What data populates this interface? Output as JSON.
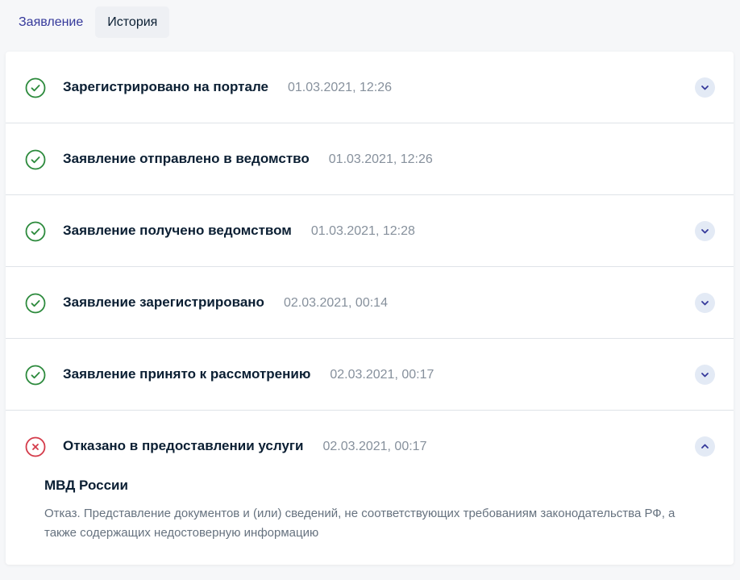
{
  "tabs": [
    {
      "label": "Заявление",
      "active": false
    },
    {
      "label": "История",
      "active": true
    }
  ],
  "history": [
    {
      "title": "Зарегистрировано на портале",
      "date": "01.03.2021, 12:26",
      "status": "success",
      "expandable": true,
      "expanded": false
    },
    {
      "title": "Заявление отправлено в ведомство",
      "date": "01.03.2021, 12:26",
      "status": "success",
      "expandable": false,
      "expanded": false
    },
    {
      "title": "Заявление получено ведомством",
      "date": "01.03.2021, 12:28",
      "status": "success",
      "expandable": true,
      "expanded": false
    },
    {
      "title": "Заявление зарегистрировано",
      "date": "02.03.2021, 00:14",
      "status": "success",
      "expandable": true,
      "expanded": false
    },
    {
      "title": "Заявление принято к рассмотрению",
      "date": "02.03.2021, 00:17",
      "status": "success",
      "expandable": true,
      "expanded": false
    },
    {
      "title": "Отказано в предоставлении услуги",
      "date": "02.03.2021, 00:17",
      "status": "error",
      "expandable": true,
      "expanded": true,
      "detail": {
        "org": "МВД России",
        "text": "Отказ. Представление документов и (или) сведений, не соответствующих требованиям законодательства РФ, а также содержащих недостоверную информацию"
      }
    }
  ],
  "colors": {
    "success": "#2c8a3c",
    "error": "#d43b4a",
    "chevron": "#35399b",
    "link": "#35399b"
  },
  "icons": {
    "success": "check-circle-icon",
    "error": "cross-circle-icon",
    "collapsed": "chevron-down-icon",
    "expanded": "chevron-up-icon"
  }
}
